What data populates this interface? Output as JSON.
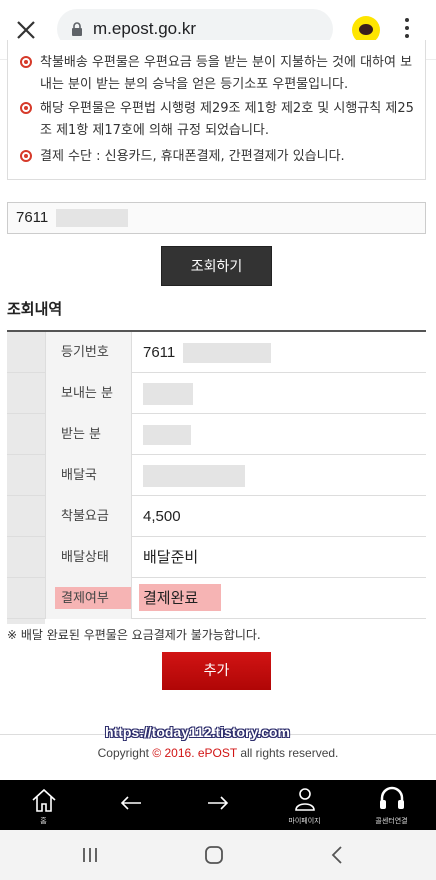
{
  "browser": {
    "url": "m.epost.go.kr"
  },
  "notice": {
    "items": [
      "착불배송 우편물은 우편요금 등을 받는 분이 지불하는 것에 대하여 보내는 분이 받는 분의 승낙을 얻은 등기소포 우편물입니다.",
      "해당 우편물은 우편법 시행령 제29조 제1항 제2호 및 시행규칙 제25조 제1항 제17호에 의해 규정 되었습니다.",
      "결제 수단 : 신용카드, 휴대폰결제, 간편결제가 있습니다."
    ]
  },
  "search": {
    "value_prefix": "7611",
    "button_label": "조회하기"
  },
  "result": {
    "title": "조회내역",
    "rows": [
      {
        "label": "등기번호",
        "value": "7611"
      },
      {
        "label": "보내는 분",
        "value": ""
      },
      {
        "label": "받는 분",
        "value": ""
      },
      {
        "label": "배달국",
        "value": ""
      },
      {
        "label": "착불요금",
        "value": "4,500"
      },
      {
        "label": "배달상태",
        "value": "배달준비"
      },
      {
        "label": "결제여부",
        "value": "결제완료"
      }
    ]
  },
  "note": "※ 배달 완료된 우편물은 요금결제가 불가능합니다.",
  "add_button_label": "추가",
  "watermark": "https://today112.tistory.com",
  "footer": {
    "copyright_pre": "Copyright ",
    "copyright_symbol": "©",
    "year_brand": " 2016. ePOST",
    "copyright_post": " all rights reserved."
  },
  "app_nav": {
    "items": [
      {
        "label": "홈",
        "icon": "home-icon"
      },
      {
        "label": "",
        "icon": "back-arrow-icon"
      },
      {
        "label": "",
        "icon": "forward-arrow-icon"
      },
      {
        "label": "마이페이지",
        "icon": "user-icon"
      },
      {
        "label": "콜센터연결",
        "icon": "headset-icon"
      }
    ]
  },
  "colors": {
    "accent_red": "#d11414",
    "highlight": "#f6b4b4",
    "dark_button": "#333333"
  }
}
